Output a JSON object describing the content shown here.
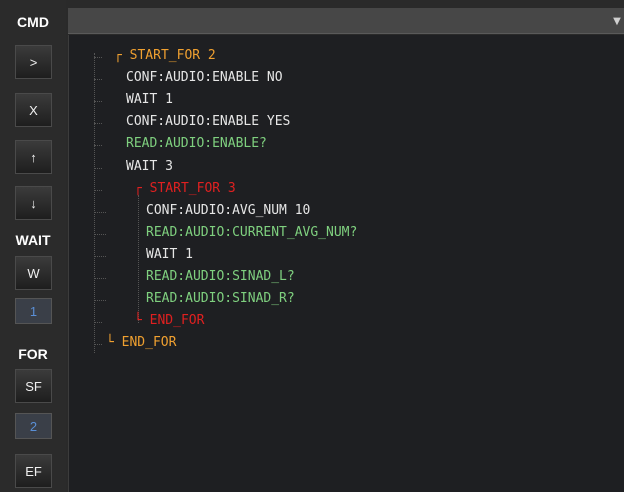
{
  "sidebar": {
    "cmd_title": "CMD",
    "buttons": [
      ">",
      "X",
      "↑",
      "↓"
    ],
    "wait_title": "WAIT",
    "wait_button": "W",
    "wait_value": "1",
    "for_title": "FOR",
    "sf_button": "SF",
    "for_value": "2",
    "ef_button": "EF"
  },
  "topbar": {
    "arrow": "▼"
  },
  "code": [
    {
      "text": "┌ START_FOR 2",
      "color": "orange"
    },
    {
      "text": "CONF:AUDIO:ENABLE NO",
      "color": "white"
    },
    {
      "text": "WAIT 1",
      "color": "white"
    },
    {
      "text": "CONF:AUDIO:ENABLE YES",
      "color": "white"
    },
    {
      "text": "READ:AUDIO:ENABLE?",
      "color": "green"
    },
    {
      "text": "WAIT 3",
      "color": "white"
    },
    {
      "text": "┌ START_FOR 3",
      "color": "red"
    },
    {
      "text": "CONF:AUDIO:AVG_NUM 10",
      "color": "white"
    },
    {
      "text": "READ:AUDIO:CURRENT_AVG_NUM?",
      "color": "green"
    },
    {
      "text": "WAIT 1",
      "color": "white"
    },
    {
      "text": "READ:AUDIO:SINAD_L?",
      "color": "green"
    },
    {
      "text": "READ:AUDIO:SINAD_R?",
      "color": "green"
    },
    {
      "text": "└ END_FOR",
      "color": "red"
    },
    {
      "text": "└ END_FOR",
      "color": "orange"
    }
  ],
  "colors": {
    "orange": "#f0a030",
    "red": "#e02020",
    "green": "#7fd07f",
    "white": "#e6e6e6"
  }
}
